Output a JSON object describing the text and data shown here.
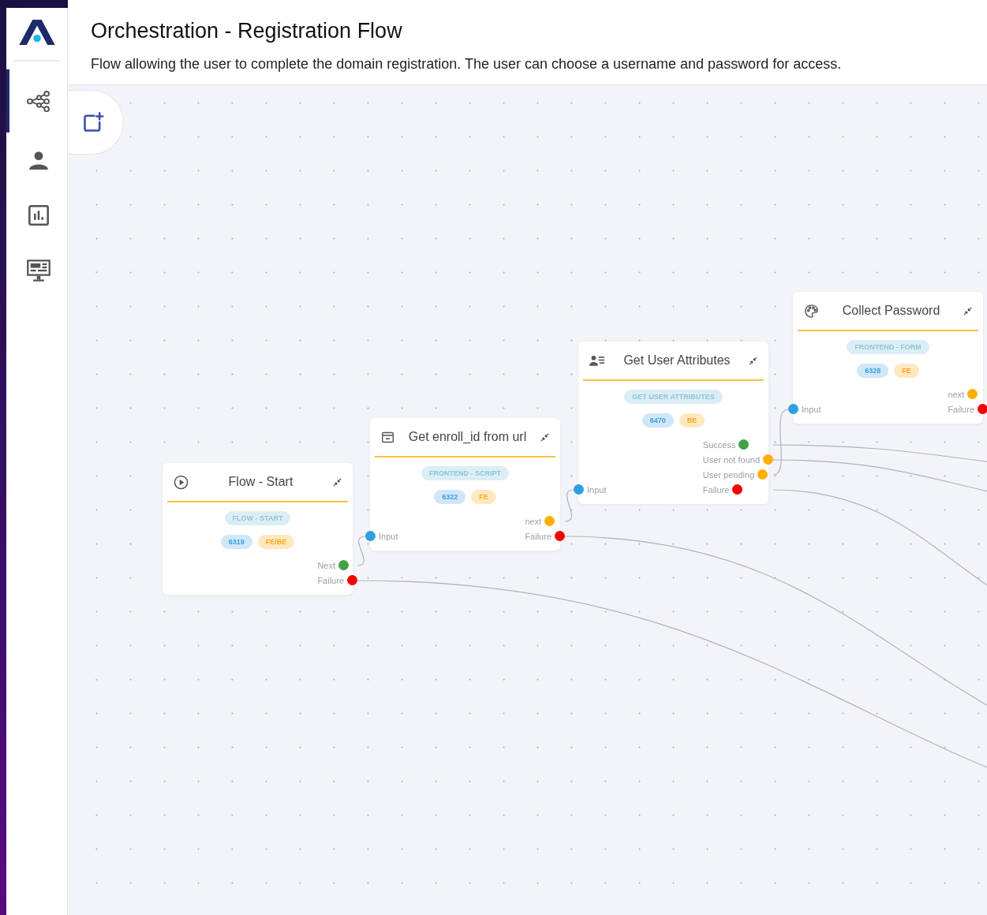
{
  "header": {
    "title": "Orchestration - Registration Flow",
    "description": "Flow allowing the user to complete the domain registration. The user can choose a username and password for access."
  },
  "sidebar": {
    "items": [
      {
        "kind": "flows",
        "selected": true
      },
      {
        "kind": "users",
        "selected": false
      },
      {
        "kind": "reports",
        "selected": false
      },
      {
        "kind": "monitor",
        "selected": false
      }
    ]
  },
  "nodes": [
    {
      "kind": "start",
      "title": "Flow - Start",
      "type_tag": "FLOW - START",
      "id_tag": "6319",
      "env_tag": "FE/BE",
      "outputs": [
        {
          "label": "Next",
          "color": "#43a047"
        },
        {
          "label": "Failure",
          "color": "#f40000"
        }
      ]
    },
    {
      "kind": "script",
      "title": "Get enroll_id from url",
      "type_tag": "FRONTEND - SCRIPT",
      "id_tag": "6322",
      "env_tag": "FE",
      "input": "Input",
      "outputs": [
        {
          "label": "next",
          "color": "#ffae00"
        },
        {
          "label": "Failure",
          "color": "#f40000"
        }
      ]
    },
    {
      "kind": "attributes",
      "title": "Get User Attributes",
      "type_tag": "GET USER ATTRIBUTES",
      "id_tag": "6470",
      "env_tag": "BE",
      "input": "Input",
      "outputs": [
        {
          "label": "Success",
          "color": "#43a047"
        },
        {
          "label": "User not found",
          "color": "#ffae00"
        },
        {
          "label": "User pending",
          "color": "#ffae00"
        },
        {
          "label": "Failure",
          "color": "#f40000"
        }
      ]
    },
    {
      "kind": "form",
      "title": "Collect Password",
      "type_tag": "FRONTEND - FORM",
      "id_tag": "6328",
      "env_tag": "FE",
      "input": "Input",
      "outputs": [
        {
          "label": "next",
          "color": "#ffae00"
        },
        {
          "label": "Failure",
          "color": "#f40000"
        }
      ]
    }
  ]
}
